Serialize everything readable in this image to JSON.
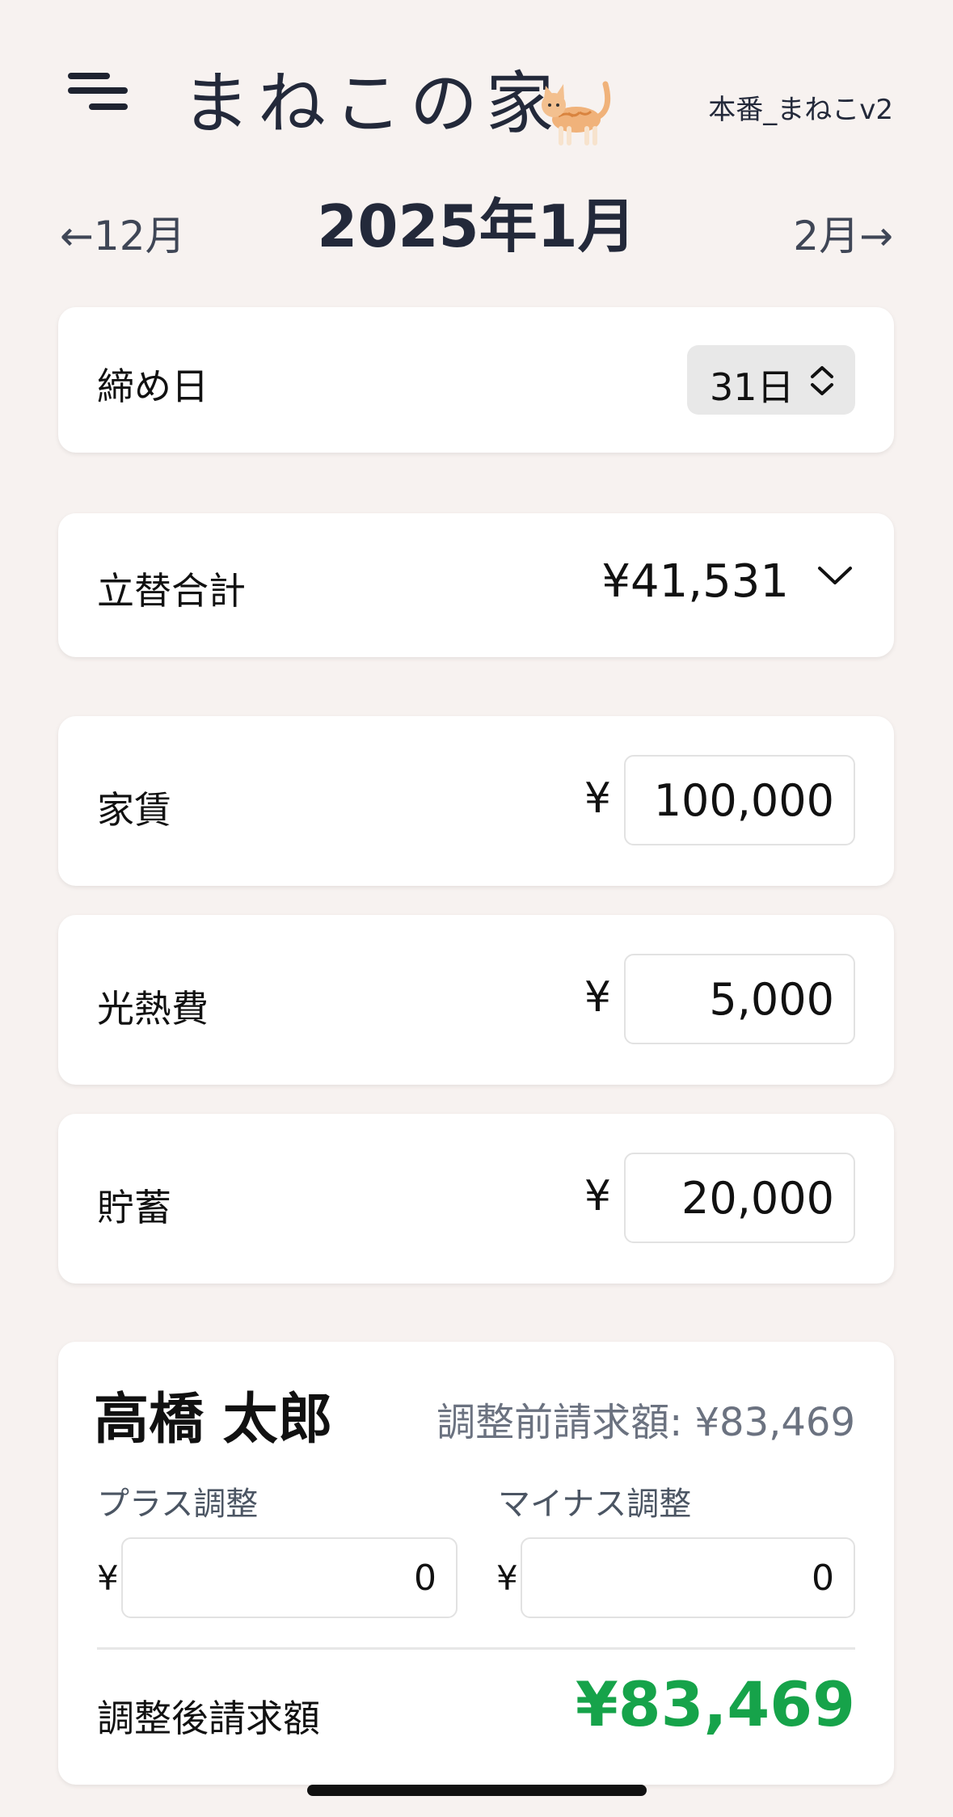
{
  "header": {
    "app_title": "まねこの家",
    "env_label": "本番_まねこv2",
    "icons": [
      "menu-icon",
      "cat-icon"
    ]
  },
  "month_nav": {
    "prev_label": "←12月",
    "current": "2025年1月",
    "next_label": "2月→"
  },
  "closing_day": {
    "label": "締め日",
    "value": "31日",
    "icon": "up-down-chevron-icon"
  },
  "advance_total": {
    "label": "立替合計",
    "amount": "¥41,531",
    "icon": "chevron-down-icon"
  },
  "fixed_costs": [
    {
      "label": "家賃",
      "currency": "¥",
      "value": "100,000"
    },
    {
      "label": "光熱費",
      "currency": "¥",
      "value": "5,000"
    },
    {
      "label": "貯蓄",
      "currency": "¥",
      "value": "20,000"
    }
  ],
  "person": {
    "name": "高橋 太郎",
    "pre_adjust": "調整前請求額: ¥83,469",
    "plus_label": "プラス調整",
    "minus_label": "マイナス調整",
    "currency": "¥",
    "plus_value": "0",
    "minus_value": "0",
    "final_label": "調整後請求額",
    "final_amount": "¥83,469",
    "final_color": "#16a34a"
  },
  "colors": {
    "background": "#f7f2f0",
    "card": "#ffffff",
    "title": "#23293a",
    "accent_green": "#16a34a"
  }
}
